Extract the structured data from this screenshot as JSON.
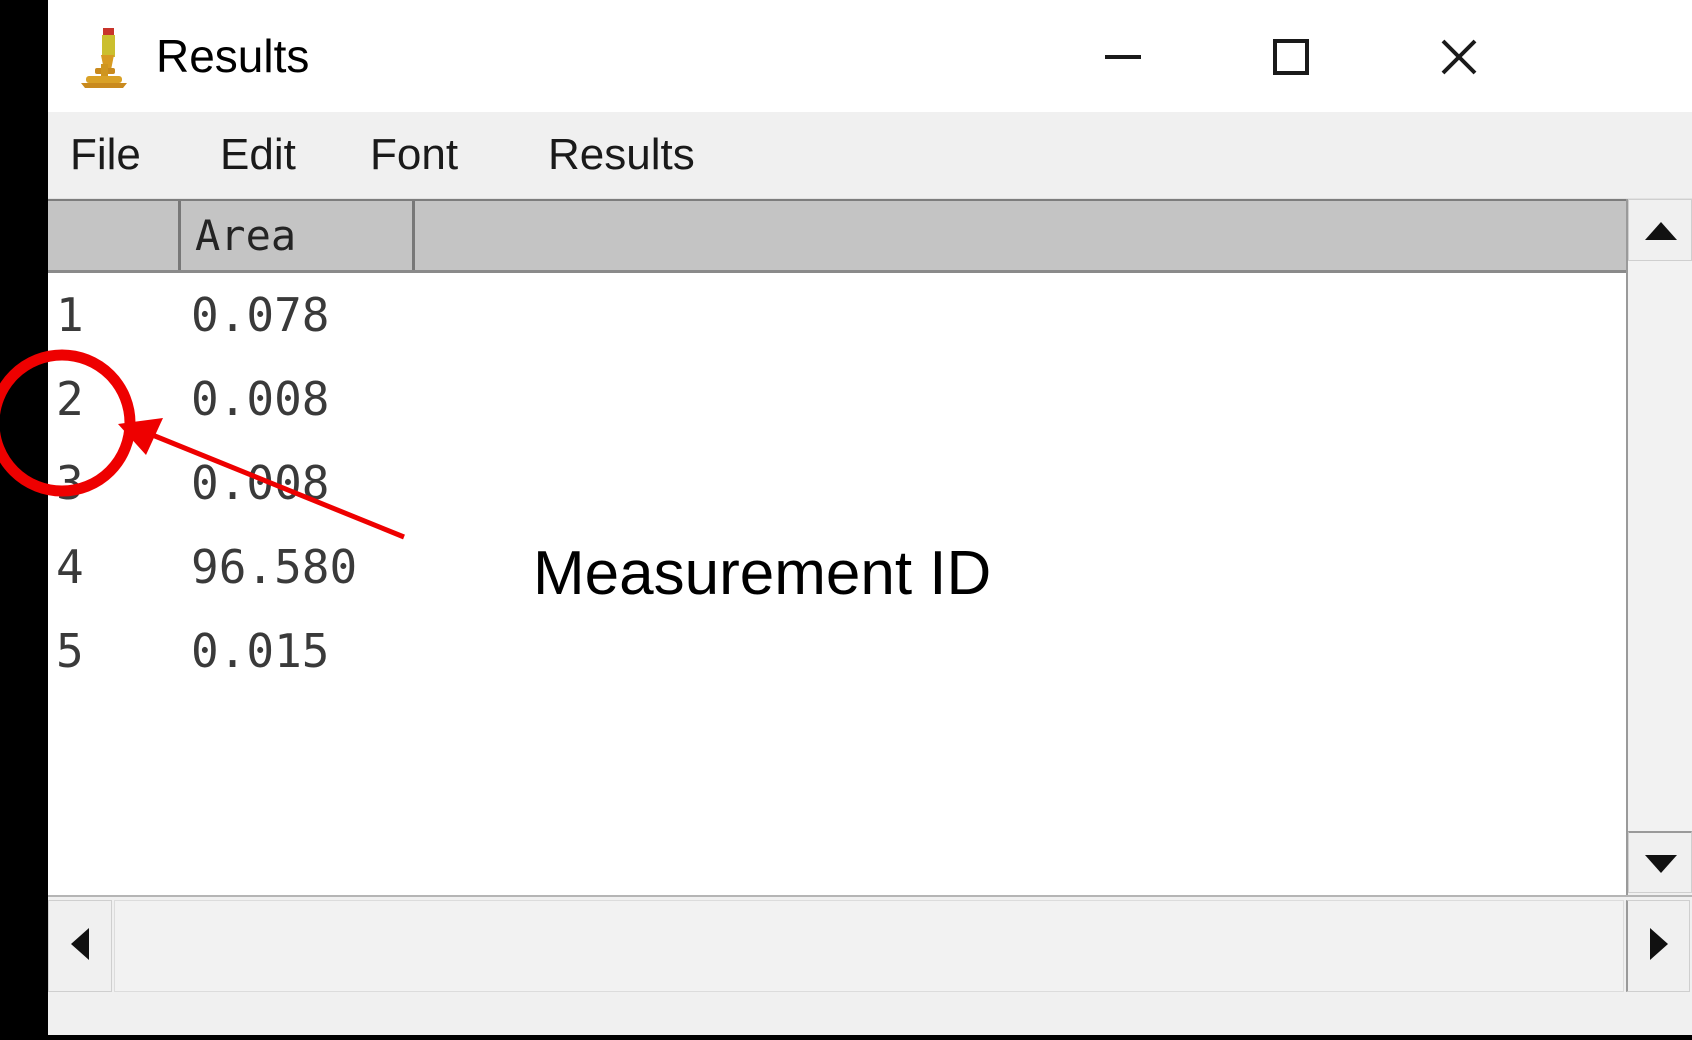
{
  "window": {
    "title": "Results",
    "icon": "microscope-icon",
    "controls": {
      "minimize": "—",
      "maximize": "☐",
      "close": "✕"
    }
  },
  "menubar": {
    "items": [
      {
        "label": "File"
      },
      {
        "label": "Edit"
      },
      {
        "label": "Font"
      },
      {
        "label": "Results"
      }
    ]
  },
  "table": {
    "headers": [
      "",
      "Area",
      ""
    ],
    "rows": [
      {
        "index": "1",
        "area": "0.078"
      },
      {
        "index": "2",
        "area": "0.008"
      },
      {
        "index": "3",
        "area": "0.008"
      },
      {
        "index": "4",
        "area": "96.580"
      },
      {
        "index": "5",
        "area": "0.015"
      }
    ]
  },
  "scrollbars": {
    "vertical": {
      "up": "▲",
      "down": "▼"
    },
    "horizontal": {
      "left": "◀",
      "right": "▶"
    }
  },
  "annotation": {
    "label": "Measurement ID",
    "color": "#ee0000",
    "target_row": "2"
  }
}
